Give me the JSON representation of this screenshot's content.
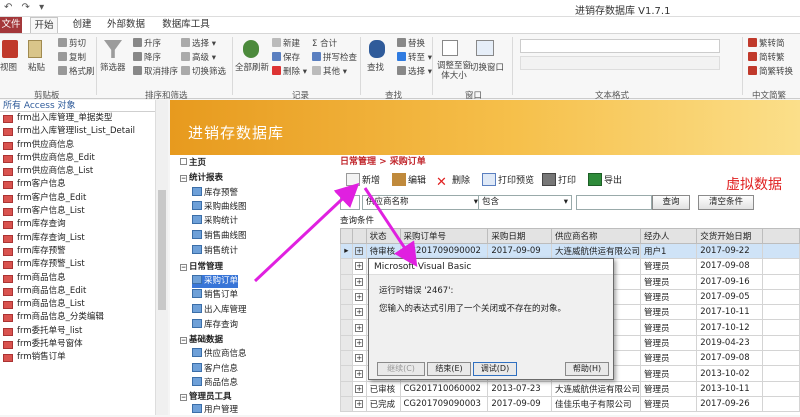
{
  "window": {
    "title": "进销存数据库 V1.7.1",
    "qat": "↶ ↷ ▾"
  },
  "ribbon_tabs": [
    {
      "label": "文件"
    },
    {
      "label": "开始"
    },
    {
      "label": "创建"
    },
    {
      "label": "外部数据"
    },
    {
      "label": "数据库工具"
    }
  ],
  "ribbon": {
    "view": "视图",
    "paste": "粘贴",
    "cut": "剪切",
    "copy": "复制",
    "format_painter": "格式刷",
    "clipboard_group": "剪贴板",
    "filter": "筛选器",
    "asc": "升序",
    "desc": "降序",
    "remove_sort": "取消排序",
    "selection": "选择",
    "advanced": "高级",
    "toggle_filter": "切换筛选",
    "sort_group": "排序和筛选",
    "refresh_all": "全部刷新",
    "new": "新建",
    "save": "保存",
    "delete": "删除",
    "totals": "合计",
    "spelling": "拼写检查",
    "more": "其他",
    "records_group": "记录",
    "find": "查找",
    "replace": "替换",
    "goto": "转至",
    "select": "选择",
    "find_group": "查找",
    "fit_window": "调整至窗体大小",
    "switch_window": "切换窗口",
    "window_group": "窗口",
    "text_format_group": "文本格式",
    "trad_to_simp": "繁转简",
    "simp_to_trad": "简转繁",
    "convert": "简繁转换",
    "chinese_group": "中文简繁"
  },
  "nav": {
    "header": "所有 Access 对象",
    "items": [
      "frm出入库管理_单据类型",
      "frm出入库管理list_List_Detail",
      "frm供应商信息",
      "frm供应商信息_Edit",
      "frm供应商信息_List",
      "frm客户信息",
      "frm客户信息_Edit",
      "frm客户信息_List",
      "frm库存查询",
      "frm库存查询_List",
      "frm库存预警",
      "frm库存预警_List",
      "frm商品信息",
      "frm商品信息_Edit",
      "frm商品信息_List",
      "frm商品信息_分类编辑",
      "frm委托单号_list",
      "frm委托单号窗体",
      "frm销售订单"
    ]
  },
  "app": {
    "banner_title": "进销存数据库",
    "watermark": "虚拟数据",
    "breadcrumb": "日常管理 > 采购订单",
    "tree": {
      "home": "主页",
      "stats": "统计报表",
      "stock_warning": "库存预警",
      "purchase_curve": "采购曲线图",
      "purchase_stats": "采购统计",
      "sales_curve": "销售曲线图",
      "sales_stats": "销售统计",
      "daily": "日常管理",
      "purchase_order": "采购订单",
      "sales_order": "销售订单",
      "inout": "出入库管理",
      "stock_query": "库存查询",
      "basic": "基础数据",
      "supplier_info": "供应商信息",
      "customer_info": "客户信息",
      "product_info": "商品信息",
      "admin_tools": "管理员工具",
      "user_mgmt": "用户管理"
    },
    "toolbar": {
      "new": "新增",
      "edit": "编辑",
      "delete": "删除",
      "print_preview": "打印预览",
      "print": "打印",
      "export": "导出"
    },
    "filter": {
      "field": "供应商名称",
      "op": "包含",
      "value": "",
      "query": "查询",
      "clear": "清空条件"
    },
    "query_label": "查询条件",
    "columns": [
      "状态",
      "采购订单号",
      "采购日期",
      "供应商名称",
      "经办人",
      "交货开始日期"
    ],
    "rows": [
      [
        "待审核",
        "CG201709090002",
        "2017-09-09",
        "大连威航供运有限公司",
        "用户1",
        "2017-09-22"
      ],
      [
        "",
        "",
        "",
        "",
        "管理员",
        "2017-09-08"
      ],
      [
        "",
        "",
        "",
        "",
        "管理员",
        "2017-09-16"
      ],
      [
        "",
        "",
        "",
        "",
        "管理员",
        "2017-09-05"
      ],
      [
        "",
        "",
        "",
        "",
        "管理员",
        "2017-10-11"
      ],
      [
        "",
        "",
        "",
        "",
        "管理员",
        "2017-10-12"
      ],
      [
        "",
        "",
        "",
        "",
        "管理员",
        "2019-04-23"
      ],
      [
        "",
        "",
        "",
        "",
        "管理员",
        "2017-09-08"
      ],
      [
        "",
        "",
        "",
        "",
        "管理员",
        "2013-10-02"
      ],
      [
        "已审核",
        "CG201710060002",
        "2013-07-23",
        "大连威航供运有限公司",
        "管理员",
        "2013-10-11"
      ],
      [
        "已完成",
        "CG201709090003",
        "2017-09-09",
        "佳佳乐电子有限公司",
        "管理员",
        "2017-09-26"
      ]
    ]
  },
  "dialog": {
    "title": "Microsoft Visual Basic",
    "line1": "运行时错误 '2467':",
    "line2": "您输入的表达式引用了一个关闭或不存在的对象。",
    "continue": "继续(C)",
    "end": "结束(E)",
    "debug": "调试(D)",
    "help": "帮助(H)"
  },
  "colors": {
    "banner": "#f0a830",
    "accent_red": "#e02020",
    "arrow": "#e020e0"
  }
}
